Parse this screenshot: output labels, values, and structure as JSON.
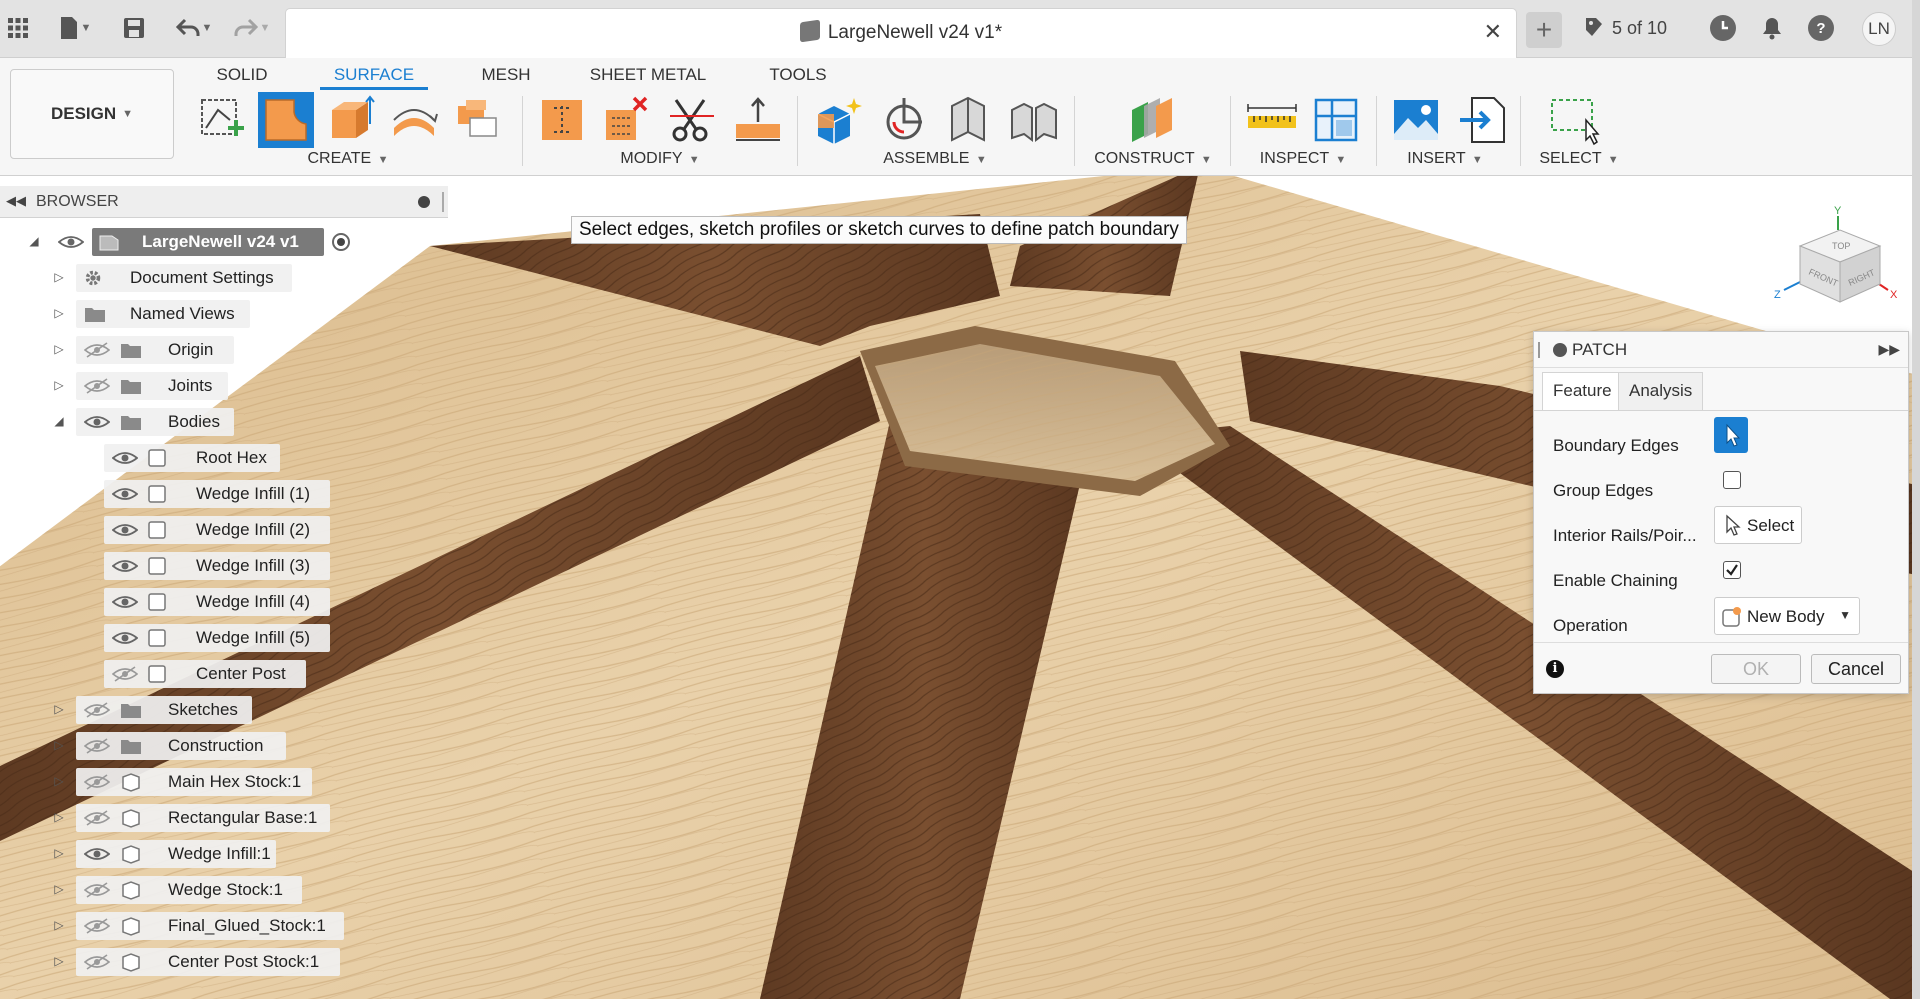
{
  "titlebar": {
    "document_title": "LargeNewell v24 v1*",
    "version": "5 of 10",
    "user_initials": "LN",
    "icons": [
      "app-grid-icon",
      "file-icon",
      "save-icon",
      "undo-icon",
      "redo-icon",
      "close-icon",
      "new-tab-icon",
      "version-icon",
      "clock-icon",
      "bell-icon",
      "help-icon"
    ]
  },
  "toolbar": {
    "workspace_tabs": [
      "SOLID",
      "SURFACE",
      "MESH",
      "SHEET METAL",
      "TOOLS"
    ],
    "active_tab": "SURFACE",
    "design_button": "DESIGN",
    "groups": [
      "CREATE",
      "MODIFY",
      "ASSEMBLE",
      "CONSTRUCT",
      "INSPECT",
      "INSERT",
      "SELECT"
    ]
  },
  "viewport": {
    "hint": "Select edges, sketch profiles or sketch curves to define patch boundary",
    "viewcube_labels": [
      "TOP",
      "FRONT",
      "RIGHT"
    ],
    "axis_labels": [
      "Y",
      "Z",
      "X"
    ]
  },
  "browser": {
    "title": "BROWSER",
    "root": "LargeNewell v24 v1",
    "items": {
      "document_settings": "Document Settings",
      "named_views": "Named Views",
      "origin": "Origin",
      "joints": "Joints",
      "bodies": "Bodies",
      "root_hex": "Root Hex",
      "wedge1": "Wedge Infill (1)",
      "wedge2": "Wedge Infill (2)",
      "wedge3": "Wedge Infill (3)",
      "wedge4": "Wedge Infill (4)",
      "wedge5": "Wedge Infill (5)",
      "center_post": "Center Post",
      "sketches": "Sketches",
      "construction": "Construction",
      "main_hex_stock": "Main Hex Stock:1",
      "rect_base": "Rectangular Base:1",
      "wedge_infill": "Wedge Infill:1",
      "wedge_stock": "Wedge Stock:1",
      "final_glued": "Final_Glued_Stock:1",
      "center_post_stock": "Center Post Stock:1"
    }
  },
  "patch": {
    "title": "PATCH",
    "tabs": [
      "Feature",
      "Analysis"
    ],
    "active_tab": "Feature",
    "boundary_edges_label": "Boundary Edges",
    "group_edges_label": "Group Edges",
    "group_edges_checked": false,
    "interior_rails_label": "Interior Rails/Poir...",
    "interior_rails_button": "Select",
    "enable_chaining_label": "Enable Chaining",
    "enable_chaining_checked": true,
    "operation_label": "Operation",
    "operation_value": "New Body",
    "ok_label": "OK",
    "cancel_label": "Cancel",
    "info_glyph": "i"
  },
  "colors": {
    "accent": "#1b7fd1",
    "light_wood": "#e3c89e",
    "dark_wood": "#6b4428",
    "tool_orange": "#f39a4c"
  }
}
